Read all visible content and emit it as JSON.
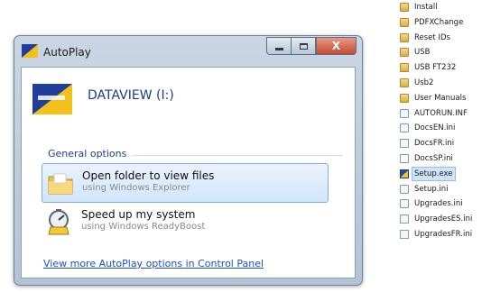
{
  "window": {
    "title": "AutoPlay",
    "controls": [
      "minimize",
      "maximize",
      "close"
    ],
    "close_glyph": "X"
  },
  "drive": {
    "title": "DATAVIEW (I:)",
    "icon": "dataview-logo-icon"
  },
  "general_options": {
    "title": "General options",
    "items": [
      {
        "label": "Open folder to view files",
        "sublabel": "using Windows Explorer",
        "icon": "folder-icon",
        "selected": true
      },
      {
        "label": "Speed up my system",
        "sublabel": "using Windows ReadyBoost",
        "icon": "readyboost-icon",
        "selected": false
      }
    ]
  },
  "more_link": "View more AutoPlay options in Control Panel",
  "file_list": [
    {
      "name": "Install",
      "type": "folder"
    },
    {
      "name": "PDFXChange",
      "type": "folder"
    },
    {
      "name": "Reset IDs",
      "type": "folder"
    },
    {
      "name": "USB",
      "type": "folder"
    },
    {
      "name": "USB FT232",
      "type": "folder"
    },
    {
      "name": "Usb2",
      "type": "folder"
    },
    {
      "name": "User Manuals",
      "type": "folder"
    },
    {
      "name": "AUTORUN.INF",
      "type": "file"
    },
    {
      "name": "DocsEN.ini",
      "type": "file"
    },
    {
      "name": "DocsFR.ini",
      "type": "file"
    },
    {
      "name": "DocsSP.ini",
      "type": "file"
    },
    {
      "name": "Setup.exe",
      "type": "setup",
      "selected": true
    },
    {
      "name": "Setup.ini",
      "type": "file"
    },
    {
      "name": "Upgrades.ini",
      "type": "file"
    },
    {
      "name": "UpgradesES.ini",
      "type": "file"
    },
    {
      "name": "UpgradesFR.ini",
      "type": "file"
    }
  ],
  "colors": {
    "link": "#1b50c7",
    "section_title": "#1e3e8e",
    "selection": "#d2e5fb",
    "close_button": "#c54a32"
  }
}
